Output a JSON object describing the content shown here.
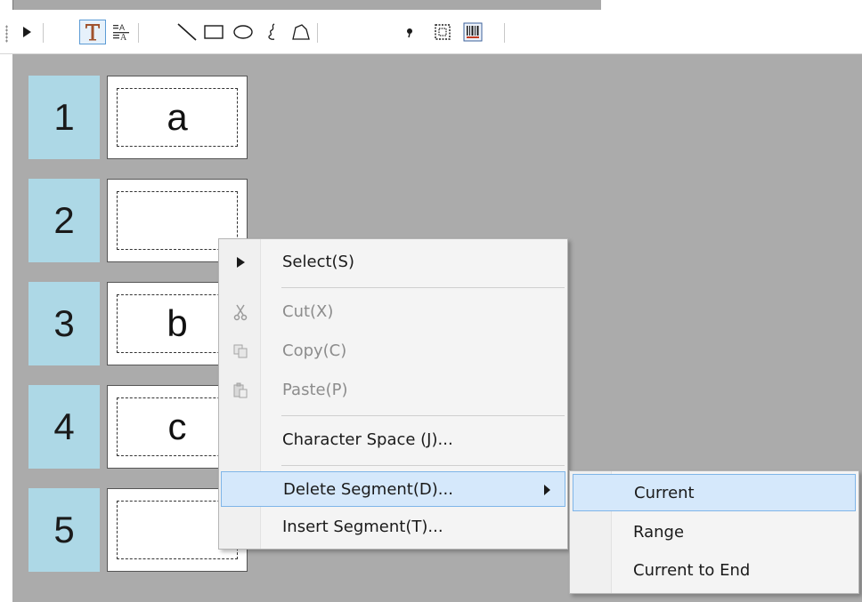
{
  "toolbar": {
    "tools": [
      {
        "name": "pointer",
        "icon": "pointer-icon",
        "active": false
      },
      {
        "name": "text",
        "icon": "text-T-icon",
        "active": true
      },
      {
        "name": "text-format",
        "icon": "text-format-icon",
        "active": false
      },
      {
        "name": "line",
        "icon": "line-icon",
        "active": false
      },
      {
        "name": "rectangle",
        "icon": "rectangle-icon",
        "active": false
      },
      {
        "name": "ellipse",
        "icon": "ellipse-icon",
        "active": false
      },
      {
        "name": "freehand",
        "icon": "freehand-icon",
        "active": false
      },
      {
        "name": "polygon",
        "icon": "polygon-icon",
        "active": false
      },
      {
        "name": "dot",
        "icon": "dot-icon",
        "active": false
      },
      {
        "name": "frame",
        "icon": "dotted-frame-icon",
        "active": false
      },
      {
        "name": "barcode",
        "icon": "barcode-icon",
        "active": false
      }
    ]
  },
  "segments": [
    {
      "number": "1",
      "text": "a"
    },
    {
      "number": "2",
      "text": ""
    },
    {
      "number": "3",
      "text": "b"
    },
    {
      "number": "4",
      "text": "c"
    },
    {
      "number": "5",
      "text": ""
    }
  ],
  "context_menu": {
    "select": "Select(S)",
    "cut": "Cut(X)",
    "copy": "Copy(C)",
    "paste": "Paste(P)",
    "character_space": "Character Space (J)...",
    "delete_segment": "Delete Segment(D)...",
    "insert_segment": "Insert Segment(T)..."
  },
  "submenu": {
    "current": "Current",
    "range": "Range",
    "current_to_end": "Current to End"
  },
  "colors": {
    "canvas": "#ababab",
    "segment_number_bg": "#add8e6",
    "menu_hover": "#d5e8fb",
    "menu_hover_border": "#7fb5e8",
    "active_tool_border": "#5b9bd5"
  }
}
